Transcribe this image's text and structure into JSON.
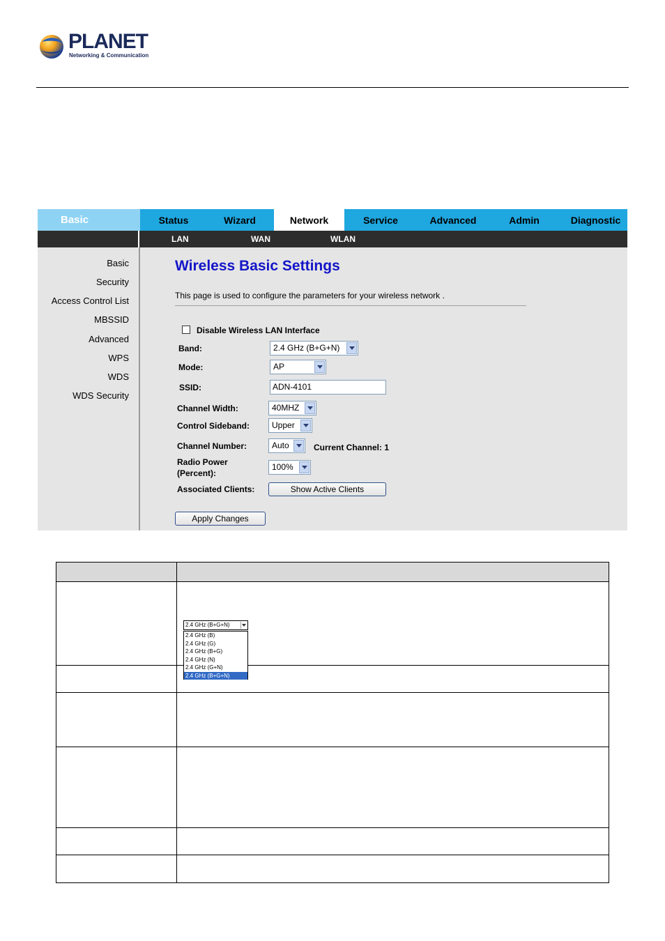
{
  "logo": {
    "name": "PLANET",
    "tagline": "Networking & Communication"
  },
  "topnav": {
    "brand": "Basic",
    "tabs": [
      "Status",
      "Wizard",
      "Network",
      "Service",
      "Advanced",
      "Admin",
      "Diagnostic"
    ],
    "active_tab": "Network"
  },
  "subnav": {
    "items": [
      "LAN",
      "WAN",
      "WLAN"
    ]
  },
  "sidebar": {
    "items": [
      "Basic",
      "Security",
      "Access Control List",
      "MBSSID",
      "Advanced",
      "WPS",
      "WDS",
      "WDS Security"
    ]
  },
  "main": {
    "title": "Wireless Basic Settings",
    "description": "This page is used to configure the parameters for your wireless network .",
    "disable_label": "Disable Wireless LAN Interface",
    "disable_checked": false,
    "band_label": "Band:",
    "band_value": "2.4 GHz (B+G+N)",
    "mode_label": "Mode:",
    "mode_value": "AP",
    "ssid_label": "SSID:",
    "ssid_value": "ADN-4101",
    "channel_width_label": "Channel Width:",
    "channel_width_value": "40MHZ",
    "control_sideband_label": "Control Sideband:",
    "control_sideband_value": "Upper",
    "channel_number_label": "Channel Number:",
    "channel_number_value": "Auto",
    "current_channel_label": "Current Channel: 1",
    "radio_power_label_1": "Radio Power",
    "radio_power_label_2": "(Percent):",
    "radio_power_value": "100%",
    "associated_clients_label": "Associated Clients:",
    "show_clients_button": "Show Active Clients",
    "apply_button": "Apply Changes"
  },
  "band_dropdown": {
    "selected": "2.4 GHz (B+G+N)",
    "options": [
      "2.4 GHz (B)",
      "2.4 GHz (G)",
      "2.4 GHz (B+G)",
      "2.4 GHz (N)",
      "2.4 GHz (G+N)",
      "2.4 GHz (B+G+N)"
    ],
    "highlighted_index": 5
  }
}
